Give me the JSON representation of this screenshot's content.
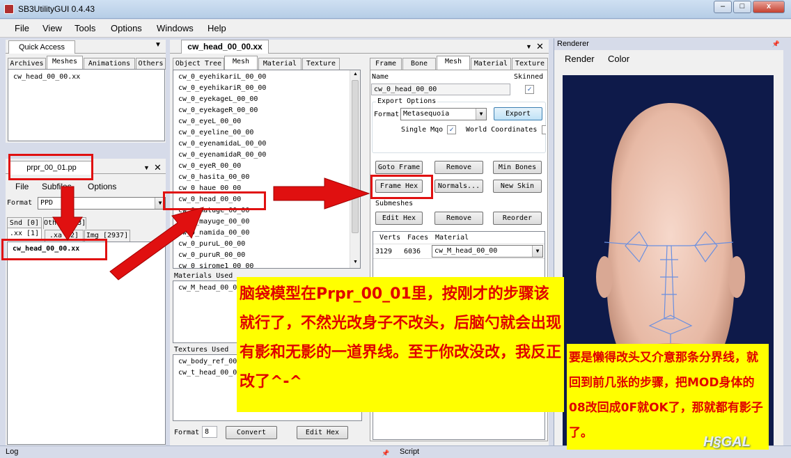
{
  "window": {
    "title": "SB3UtilityGUI 0.4.43",
    "minimize": "–",
    "maximize": "□",
    "close": "x"
  },
  "menu": [
    "File",
    "View",
    "Tools",
    "Options",
    "Windows",
    "Help"
  ],
  "quick_access": {
    "title": "Quick Access",
    "tabs": [
      "Archives",
      "Meshes",
      "Animations",
      "Others"
    ],
    "items": [
      "cw_head_00_00.xx"
    ]
  },
  "pp_panel": {
    "title": "prpr_00_01.pp",
    "menu": [
      "File",
      "Subfiles",
      "Options"
    ],
    "format_label": "Format",
    "format_value": "PPD",
    "tabs_row1": [
      "Snd [0]",
      "Others [3]"
    ],
    "tabs_row2": [
      ".xx [1]",
      ".xa [2]",
      "Img [2937]"
    ],
    "items": [
      "cw_head_00_00.xx"
    ]
  },
  "editor": {
    "title": "cw_head_00_00.xx",
    "tabs": [
      "Object Tree",
      "Mesh",
      "Material",
      "Texture"
    ],
    "meshes": [
      "cw_0_eyehikariL_00_00",
      "cw_0_eyehikariR_00_00",
      "cw_0_eyekageL_00_00",
      "cw_0_eyekageR_00_00",
      "cw_0_eyeL_00_00",
      "cw_0_eyeline_00_00",
      "cw_0_eyenamidaL_00_00",
      "cw_0_eyenamidaR_00_00",
      "cw_0_eyeR_00_00",
      "cw_0_hasita_00_00",
      "cw_0_haue_00_00",
      "cw_0_head_00_00",
      "cw_0_matuge_00_00",
      "cw_0_mayuge_00_00",
      "cw_0_namida_00_00",
      "cw_0_puruL_00_00",
      "cw_0_puruR_00_00",
      "cw_0_sirome1_00_00"
    ],
    "materials_label": "Materials Used",
    "materials": [
      "cw_M_head_00_00"
    ],
    "textures_label": "Textures Used",
    "textures": [
      "cw_body_ref_00_",
      "cw_t_head_00_00"
    ],
    "format_label": "Format",
    "format_value": "8",
    "convert": "Convert",
    "edit_hex": "Edit Hex"
  },
  "mesh_panel": {
    "tabs": [
      "Frame",
      "Bone",
      "Mesh",
      "Material",
      "Texture"
    ],
    "name_label": "Name",
    "name_value": "cw_0_head_00_00",
    "skinned_label": "Skinned",
    "skinned_checked": "✓",
    "export_options": "Export Options",
    "format_label": "Format",
    "format_value": "Metasequoia",
    "export": "Export",
    "single_mqo": "Single Mqo",
    "single_mqo_checked": "✓",
    "world_coordinates": "World Coordinates",
    "buttons_row1": [
      "Goto Frame",
      "Remove",
      "Min Bones"
    ],
    "buttons_row2": [
      "Frame Hex",
      "Normals...",
      "New Skin"
    ],
    "submeshes": "Submeshes",
    "buttons_row3": [
      "Edit Hex",
      "Remove",
      "Reorder"
    ],
    "columns": [
      "Verts",
      "Faces",
      "Material"
    ],
    "row": {
      "verts": "3129",
      "faces": "6036",
      "material": "cw_M_head_00_00"
    }
  },
  "renderer": {
    "title": "Renderer",
    "menu": [
      "Render",
      "Color"
    ]
  },
  "status": {
    "log": "Log",
    "script": "Script"
  },
  "annotations": {
    "main": "脑袋模型在Prpr_00_01里，按刚才的步骤该就行了，不然光改身子不改头，后脑勺就会出现有影和无影的一道界线。至于你改没改，我反正改了^-^",
    "side": "要是懒得改头又介意那条分界线，就回到前几张的步骤，把MOD身体的08改回成0F就OK了，那就都有影子了。",
    "watermark": "H§GAL"
  },
  "colors": {
    "highlight": "#e01010",
    "note_bg": "#ffff00",
    "note_text": "#e00000",
    "renderer_bg": "#0e1a4a"
  }
}
